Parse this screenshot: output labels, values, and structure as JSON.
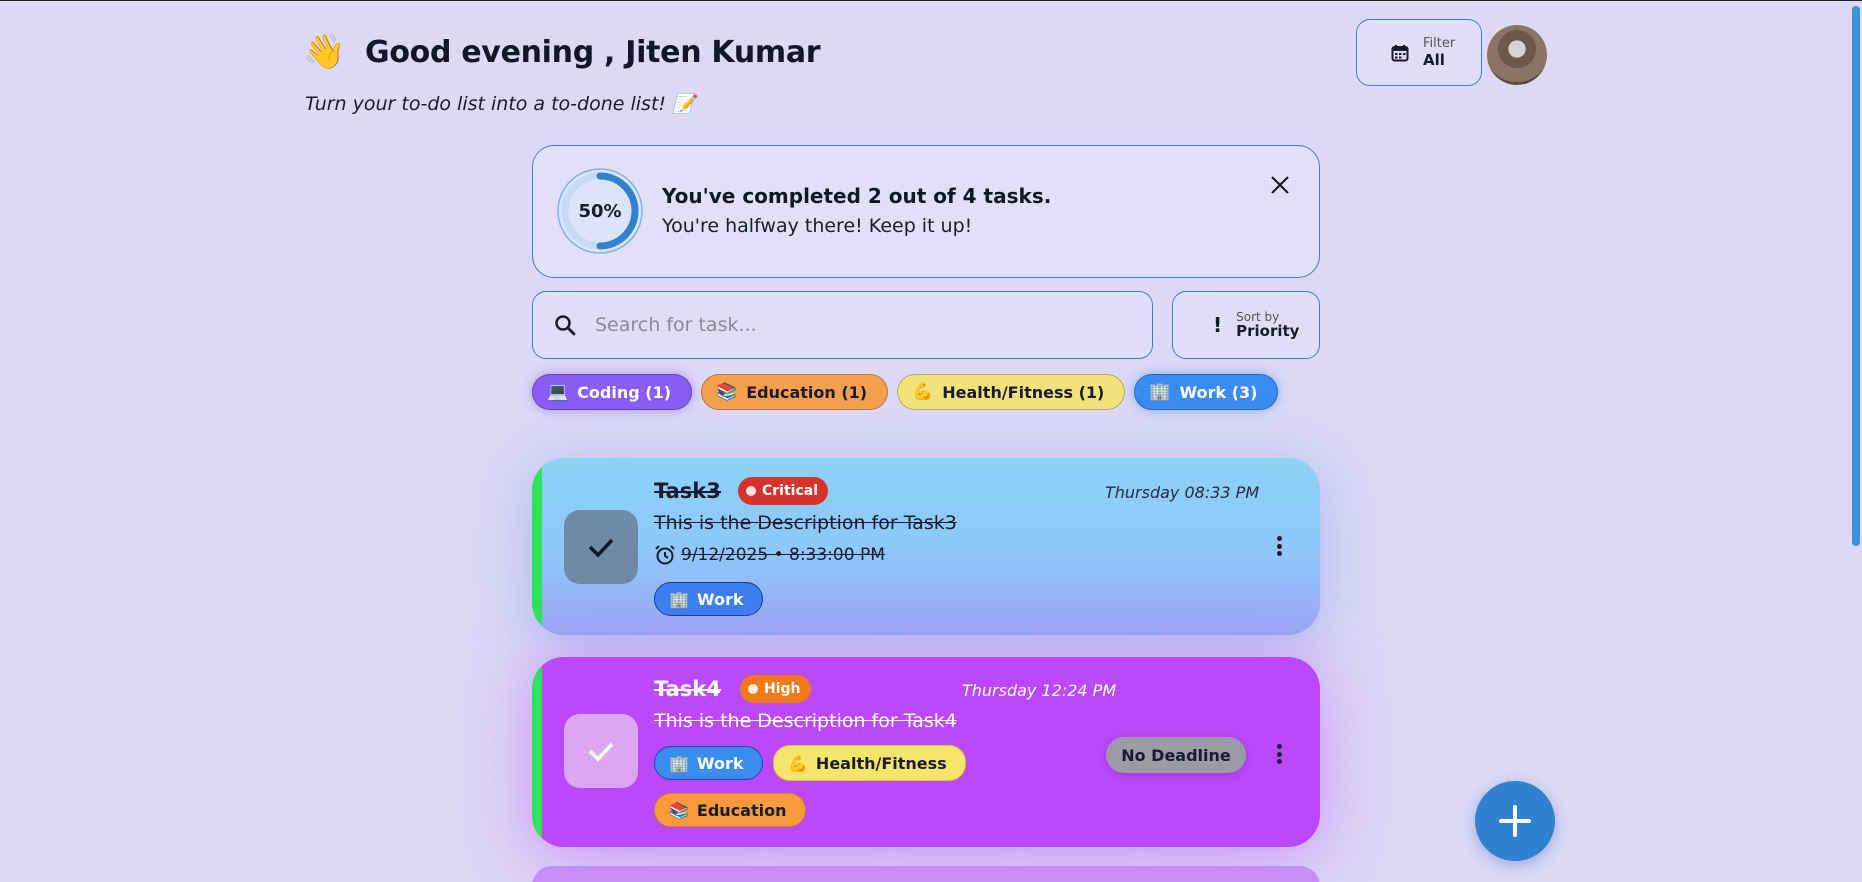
{
  "header": {
    "wave_emoji": "👋",
    "greeting": "Good evening , Jiten Kumar",
    "subtitle": "Turn your to-do list into a to-done list! 📝"
  },
  "filter": {
    "label": "Filter",
    "value": "All",
    "icon": "calendar-icon"
  },
  "progress": {
    "percent_text": "50%",
    "percent": 50,
    "title": "You've completed 2 out of 4 tasks.",
    "message": "You're halfway there! Keep it up!"
  },
  "search": {
    "placeholder": "Search for task..."
  },
  "sort": {
    "label": "Sort by",
    "value": "Priority"
  },
  "categories": [
    {
      "emoji": "💻",
      "label": "Coding (1)",
      "color": "#8b5cf6"
    },
    {
      "emoji": "📚",
      "label": "Education (1)",
      "color": "#f4a04e"
    },
    {
      "emoji": "💪",
      "label": "Health/Fitness (1)",
      "color": "#f3e27a"
    },
    {
      "emoji": "🏢",
      "label": "Work (3)",
      "color": "#3b8cf0"
    }
  ],
  "tasks": [
    {
      "title": "Task3",
      "priority": "Critical",
      "priority_color": "#d8322f",
      "created": "Thursday 08:33 PM",
      "description": "This is the Description for Task3",
      "deadline": "9/12/2025 • 8:33:00 PM",
      "tags": [
        {
          "emoji": "🏢",
          "label": "Work"
        }
      ],
      "completed": true
    },
    {
      "title": "Task4",
      "priority": "High",
      "priority_color": "#f07a1a",
      "created": "Thursday 12:24 PM",
      "description": "This is the Description for Task4",
      "deadline_label": "No Deadline",
      "tags": [
        {
          "emoji": "🏢",
          "label": "Work"
        },
        {
          "emoji": "💪",
          "label": "Health/Fitness"
        },
        {
          "emoji": "📚",
          "label": "Education"
        }
      ],
      "completed": true
    }
  ]
}
